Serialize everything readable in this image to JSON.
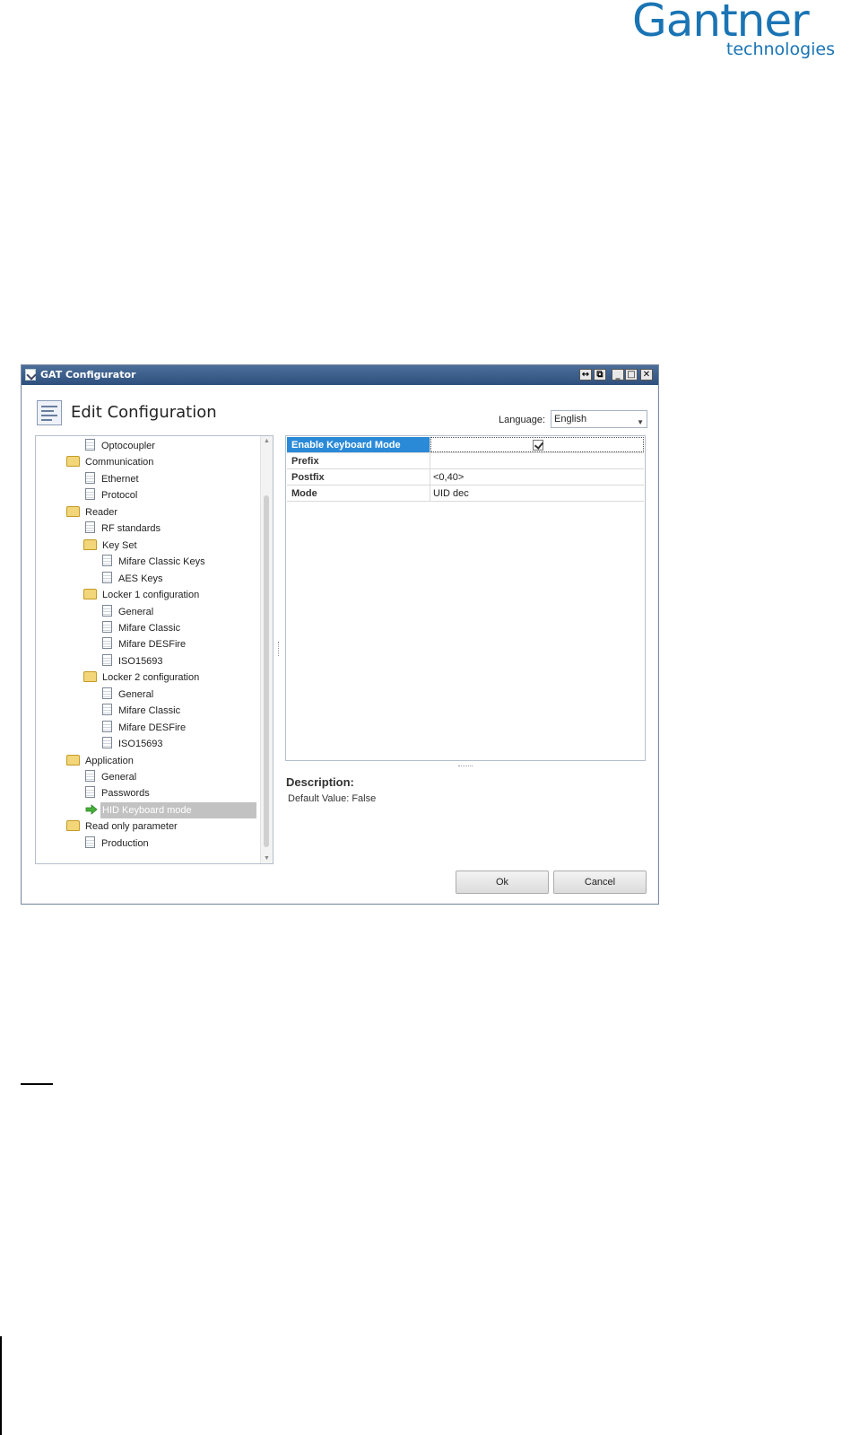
{
  "logo": {
    "main": "Gantner",
    "sub": "technologies"
  },
  "window": {
    "title": "GAT Configurator",
    "controls": [
      "↔",
      "⧉",
      "_",
      "□",
      "✕"
    ]
  },
  "header": {
    "title": "Edit Configuration"
  },
  "language": {
    "label": "Language:",
    "selected": "English"
  },
  "tree": {
    "items": [
      {
        "label": "Optocoupler",
        "type": "doc"
      },
      {
        "label": "Communication",
        "type": "folder"
      },
      {
        "label": "Ethernet",
        "type": "doc"
      },
      {
        "label": "Protocol",
        "type": "doc"
      },
      {
        "label": "Reader",
        "type": "folder"
      },
      {
        "label": "RF standards",
        "type": "doc"
      },
      {
        "label": "Key Set",
        "type": "folder"
      },
      {
        "label": "Mifare Classic Keys",
        "type": "doc"
      },
      {
        "label": "AES Keys",
        "type": "doc"
      },
      {
        "label": "Locker 1 configuration",
        "type": "folder"
      },
      {
        "label": "General",
        "type": "doc"
      },
      {
        "label": "Mifare Classic",
        "type": "doc"
      },
      {
        "label": "Mifare DESFire",
        "type": "doc"
      },
      {
        "label": "ISO15693",
        "type": "doc"
      },
      {
        "label": "Locker 2 configuration",
        "type": "folder"
      },
      {
        "label": "General",
        "type": "doc"
      },
      {
        "label": "Mifare Classic",
        "type": "doc"
      },
      {
        "label": "Mifare DESFire",
        "type": "doc"
      },
      {
        "label": "ISO15693",
        "type": "doc"
      },
      {
        "label": "Application",
        "type": "folder"
      },
      {
        "label": "General",
        "type": "doc"
      },
      {
        "label": "Passwords",
        "type": "doc"
      },
      {
        "label": "HID Keyboard mode",
        "type": "arrow",
        "selected": true
      },
      {
        "label": "Read only parameter",
        "type": "folder"
      },
      {
        "label": "Production",
        "type": "doc"
      }
    ]
  },
  "properties": [
    {
      "key": "Enable Keyboard Mode",
      "value": "",
      "checked": true
    },
    {
      "key": "Prefix",
      "value": ""
    },
    {
      "key": "Postfix",
      "value": "<0,40>"
    },
    {
      "key": "Mode",
      "value": "UID dec"
    }
  ],
  "description": {
    "title": "Description:",
    "text": "Default Value: False"
  },
  "buttons": {
    "ok": "Ok",
    "cancel": "Cancel"
  }
}
